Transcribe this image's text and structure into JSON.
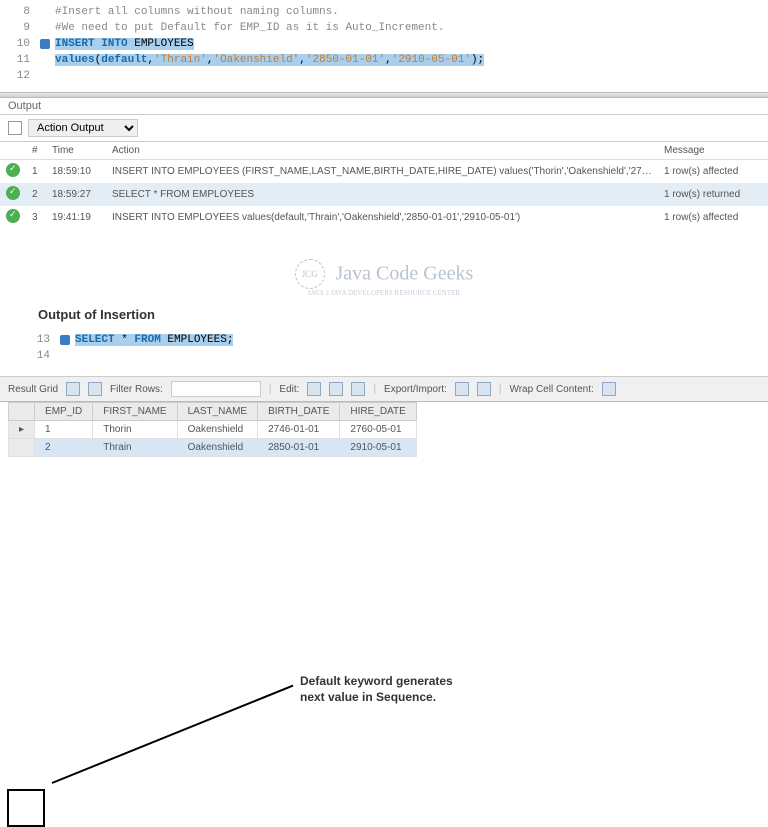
{
  "editor_top": {
    "lines": [
      {
        "n": "8",
        "marker": false,
        "html": "<span class='comment'>#Insert all columns without naming columns.</span>"
      },
      {
        "n": "9",
        "marker": false,
        "html": "<span class='comment'>#We need to put Default for EMP_ID as it is Auto_Increment.</span>"
      },
      {
        "n": "10",
        "marker": true,
        "html": "<span class='sel'><span class='keyword'>INSERT INTO</span> EMPLOYEES</span>"
      },
      {
        "n": "11",
        "marker": false,
        "html": "<span class='sel'><span class='keyword'>values</span>(<span class='keyword'>default</span>,<span class='string'>'Thrain'</span>,<span class='string'>'Oakenshield'</span>,<span class='string'>'2850-01-01'</span>,<span class='string'>'2910-05-01'</span>);</span>"
      },
      {
        "n": "12",
        "marker": false,
        "html": ""
      }
    ]
  },
  "output": {
    "label": "Output",
    "dropdown": "Action Output",
    "headers": {
      "num": "#",
      "time": "Time",
      "action": "Action",
      "message": "Message"
    },
    "rows": [
      {
        "n": "1",
        "time": "18:59:10",
        "action": "INSERT INTO EMPLOYEES (FIRST_NAME,LAST_NAME,BIRTH_DATE,HIRE_DATE) values('Thorin','Oakenshield','2746-01-01','27...",
        "message": "1 row(s) affected"
      },
      {
        "n": "2",
        "time": "18:59:27",
        "action": "SELECT * FROM EMPLOYEES",
        "message": "1 row(s) returned"
      },
      {
        "n": "3",
        "time": "19:41:19",
        "action": "INSERT INTO EMPLOYEES values(default,'Thrain','Oakenshield','2850-01-01','2910-05-01')",
        "message": "1 row(s) affected"
      }
    ]
  },
  "watermark": {
    "main": "Java Code Geeks",
    "sub": "JAVA 2 JAVA DEVELOPERS RESOURCE CENTER",
    "logo": "JCG"
  },
  "heading": "Output of Insertion",
  "annotation": "Default keyword generates next value in Sequence.",
  "editor_bottom": {
    "lines": [
      {
        "n": "13",
        "marker": true,
        "html": "<span class='sel'><span class='keyword'>SELECT</span> * <span class='keyword'>FROM</span> EMPLOYEES;</span>"
      },
      {
        "n": "14",
        "marker": false,
        "html": ""
      }
    ]
  },
  "grid_bar": {
    "title": "Result Grid",
    "filter_label": "Filter Rows:",
    "filter_value": "",
    "edit": "Edit:",
    "export": "Export/Import:",
    "wrap": "Wrap Cell Content:"
  },
  "result": {
    "cols": [
      "EMP_ID",
      "FIRST_NAME",
      "LAST_NAME",
      "BIRTH_DATE",
      "HIRE_DATE"
    ],
    "rows": [
      [
        "1",
        "Thorin",
        "Oakenshield",
        "2746-01-01",
        "2760-05-01"
      ],
      [
        "2",
        "Thrain",
        "Oakenshield",
        "2850-01-01",
        "2910-05-01"
      ]
    ]
  }
}
